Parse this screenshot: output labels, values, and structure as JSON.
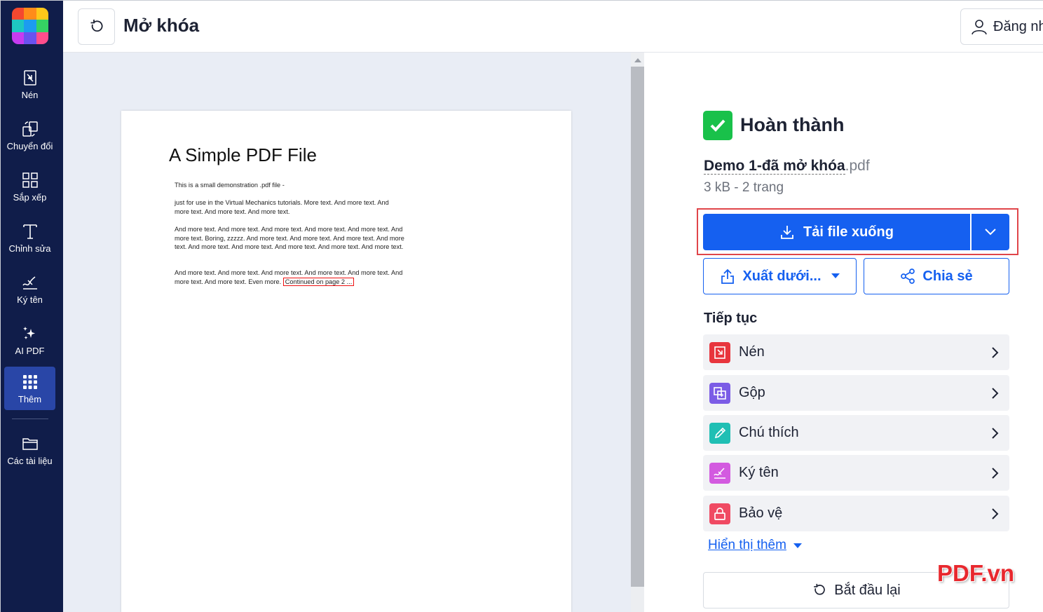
{
  "header": {
    "title": "Mở khóa",
    "login_label": "Đăng nhập"
  },
  "sidebar": {
    "items": [
      {
        "label": "Nén",
        "icon": "compress-icon"
      },
      {
        "label": "Chuyển đổi",
        "icon": "convert-icon"
      },
      {
        "label": "Sắp xếp",
        "icon": "organize-icon"
      },
      {
        "label": "Chỉnh sửa",
        "icon": "edit-text-icon"
      },
      {
        "label": "Ký tên",
        "icon": "signature-icon"
      },
      {
        "label": "AI PDF",
        "icon": "sparkle-icon"
      },
      {
        "label": "Thêm",
        "icon": "grid-dots-icon",
        "active": true
      },
      {
        "label": "Các tài liệu",
        "icon": "folder-icon"
      }
    ]
  },
  "preview": {
    "pdf_title": "A Simple PDF File",
    "paragraphs": [
      "This is a small demonstration .pdf file -",
      "just for use in the Virtual Mechanics tutorials. More text. And more text. And more text. And more text. And more text.",
      "And more text. And more text. And more text. And more text. And more text. And more text. Boring, zzzzz. And more text. And more text. And more text. And more text. And more text. And more text. And more text. And more text. And more text.",
      "And more text. And more text. And more text. And more text. And more text. And more text. And more text. Even more."
    ],
    "continued": "Continued on page 2 ..."
  },
  "result": {
    "status": "Hoàn thành",
    "file_base": "Demo 1-đã mở khóa",
    "file_ext": ".pdf",
    "file_meta": "3 kB - 2 trang",
    "download_label": "Tải file xuống",
    "export_label": "Xuất dưới...",
    "share_label": "Chia sẻ"
  },
  "continue": {
    "title": "Tiếp tục",
    "tools": [
      {
        "label": "Nén",
        "color": "#e8353d"
      },
      {
        "label": "Gộp",
        "color": "#7b5ce6"
      },
      {
        "label": "Chú thích",
        "color": "#1fbfb4"
      },
      {
        "label": "Ký tên",
        "color": "#d35ae0"
      },
      {
        "label": "Bảo vệ",
        "color": "#f04a63"
      }
    ],
    "show_more": "Hiển thị thêm",
    "restart": "Bắt đầu lại"
  },
  "watermark": "PDF.vn"
}
